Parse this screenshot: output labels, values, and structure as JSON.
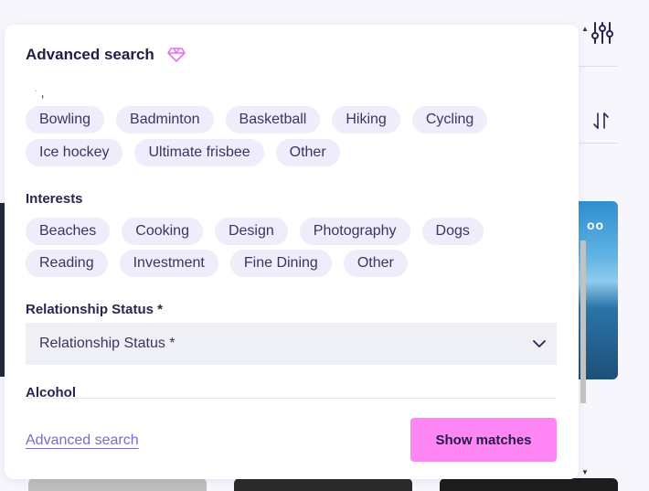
{
  "modal": {
    "title": "Advanced search",
    "partial_label": "' ,"
  },
  "sports": {
    "chips": [
      "Bowling",
      "Badminton",
      "Basketball",
      "Hiking",
      "Cycling",
      "Ice hockey",
      "Ultimate frisbee",
      "Other"
    ]
  },
  "interests": {
    "label": "Interests",
    "chips": [
      "Beaches",
      "Cooking",
      "Design",
      "Photography",
      "Dogs",
      "Reading",
      "Investment",
      "Fine Dining",
      "Other"
    ]
  },
  "relationship": {
    "label": "Relationship Status *",
    "selected": "Relationship Status *"
  },
  "alcohol": {
    "label": "Alcohol"
  },
  "footer": {
    "advanced_link": "Advanced search",
    "show_matches": "Show matches"
  },
  "background": {
    "card_dots": "oo"
  },
  "colors": {
    "accent_button": "#ff86f5",
    "chip_bg": "#efecfb",
    "link": "#7a6dc8",
    "gem": "#e86ff0"
  },
  "icons": {
    "header": "gem-icon",
    "filter": "sliders-icon",
    "sort": "sort-icon",
    "select": "chevron-down-icon"
  }
}
